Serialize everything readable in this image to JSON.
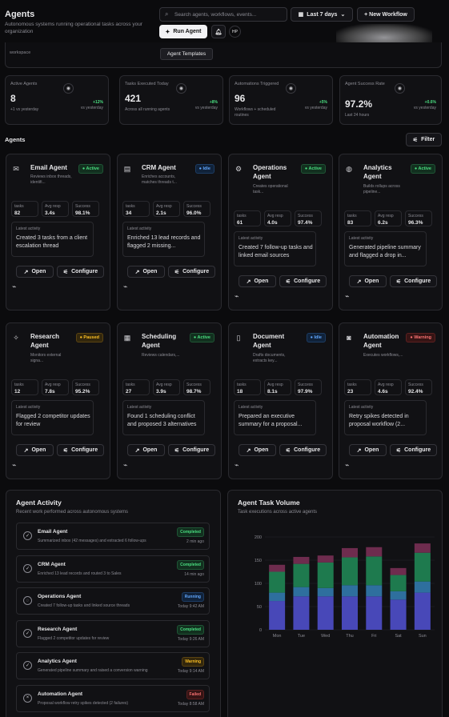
{
  "header": {
    "title": "Agents",
    "subtitle": "Autonomous systems running operational tasks across your organization",
    "search_placeholder": "Search agents, workflows, events...",
    "date_range": "Last 7 days",
    "new_workflow": "+ New Workflow",
    "run_agent": "Run Agent",
    "avatar": "HP",
    "tooltip": "Agent Templates",
    "hint": "workspace"
  },
  "kpis": [
    {
      "label": "Active Agents",
      "value": "8",
      "sub": "+1 vs yesterday",
      "change": "+12%",
      "change_sub": "vs yesterday",
      "icon": "robot-icon"
    },
    {
      "label": "Tasks Executed Today",
      "value": "421",
      "sub": "Across all running agents",
      "change": "+8%",
      "change_sub": "vs yesterday",
      "icon": "target-icon"
    },
    {
      "label": "Automations Triggered",
      "value": "96",
      "sub": "Workflows + scheduled routines",
      "change": "+5%",
      "change_sub": "vs yesterday",
      "icon": "gauge-icon"
    },
    {
      "label": "Agent Success Rate",
      "value": "97.2%",
      "sub": "Last 24 hours",
      "change": "+0.6%",
      "change_sub": "vs yesterday",
      "icon": "check-icon"
    }
  ],
  "agents_section": {
    "title": "Agents",
    "filter": "Filter"
  },
  "agents": [
    {
      "name": "Email Agent",
      "status": "Active",
      "desc": "Reviews inbox threads, identifi...",
      "tasks": "82",
      "avg": "3.4s",
      "success": "98.1%",
      "latest": "Created 3 tasks from a client escalation thread",
      "icon": "mail-icon"
    },
    {
      "name": "CRM Agent",
      "status": "Idle",
      "desc": "Enriches accounts, matches threads t...",
      "tasks": "34",
      "avg": "2.1s",
      "success": "96.0%",
      "latest": "Enriched 13 lead records and flagged 2 missing...",
      "icon": "table-icon"
    },
    {
      "name": "Operations Agent",
      "status": "Active",
      "desc": "Creates operational task...",
      "tasks": "61",
      "avg": "4.0s",
      "success": "97.4%",
      "latest": "Created 7 follow-up tasks and linked email sources",
      "icon": "gear-icon"
    },
    {
      "name": "Analytics Agent",
      "status": "Active",
      "desc": "Builds rollups across pipeline...",
      "tasks": "83",
      "avg": "6.2s",
      "success": "96.3%",
      "latest": "Generated pipeline summary and flagged a drop in...",
      "icon": "globe-icon"
    },
    {
      "name": "Research Agent",
      "status": "Paused",
      "desc": "Monitors external signa...",
      "tasks": "12",
      "avg": "7.8s",
      "success": "95.2%",
      "latest": "Flagged 2 competitor updates for review",
      "icon": "sparkle-icon"
    },
    {
      "name": "Scheduling Agent",
      "status": "Active",
      "desc": "Reviews calendars,...",
      "tasks": "27",
      "avg": "3.9s",
      "success": "98.7%",
      "latest": "Found 1 scheduling conflict and proposed 3 alternatives",
      "icon": "calendar-icon"
    },
    {
      "name": "Document Agent",
      "status": "Idle",
      "desc": "Drafts documents, extracts key...",
      "tasks": "18",
      "avg": "8.1s",
      "success": "97.9%",
      "latest": "Prepared an executive summary for a proposal...",
      "icon": "document-icon"
    },
    {
      "name": "Automation Agent",
      "status": "Warning",
      "desc": "Executes workflows,...",
      "tasks": "23",
      "avg": "4.6s",
      "success": "92.4%",
      "latest": "Retry spikes detected in proposal workflow (2...",
      "icon": "bot-icon"
    }
  ],
  "labels": {
    "tasks": "tasks",
    "avg": "Avg resp",
    "success": "Success",
    "latest": "Latest activity",
    "open": "Open",
    "configure": "Configure"
  },
  "activity": {
    "title": "Agent Activity",
    "subtitle": "Recent work performed across autonomous systems",
    "items": [
      {
        "name": "Email Agent",
        "desc": "Summarized inbox (42 messages) and extracted 6 follow-ups",
        "status": "Completed",
        "time": "2 min ago"
      },
      {
        "name": "CRM Agent",
        "desc": "Enriched 13 lead records and routed 3 to Sales",
        "status": "Completed",
        "time": "14 min ago"
      },
      {
        "name": "Operations Agent",
        "desc": "Created 7 follow-up tasks and linked source threads",
        "status": "Running",
        "time": "Today 9:42 AM"
      },
      {
        "name": "Research Agent",
        "desc": "Flagged 2 competitor updates for review",
        "status": "Completed",
        "time": "Today 9:26 AM"
      },
      {
        "name": "Analytics Agent",
        "desc": "Generated pipeline summary and raised a conversion warning",
        "status": "Warning",
        "time": "Today 9:14 AM"
      },
      {
        "name": "Automation Agent",
        "desc": "Proposal workflow retry spikes detected (2 failures)",
        "status": "Failed",
        "time": "Today 8:58 AM"
      }
    ]
  },
  "chart_data": {
    "type": "bar",
    "title": "Agent Task Volume",
    "subtitle": "Task executions across active agents",
    "categories": [
      "Mon",
      "Tue",
      "Wed",
      "Thu",
      "Fri",
      "Sat",
      "Sun"
    ],
    "ylim": [
      0,
      200
    ],
    "yticks": [
      0,
      50,
      100,
      150,
      200
    ],
    "series": [
      {
        "values": [
          62,
          72,
          72,
          72,
          72,
          65,
          80
        ],
        "color": "#4848b8"
      },
      {
        "values": [
          18,
          20,
          18,
          24,
          24,
          18,
          24
        ],
        "color": "#2e6f9e"
      },
      {
        "values": [
          45,
          50,
          55,
          60,
          62,
          35,
          62
        ],
        "color": "#1e7a4e"
      },
      {
        "values": [
          15,
          15,
          15,
          20,
          20,
          15,
          20
        ],
        "color": "#6e2c4e"
      }
    ],
    "grid": true
  }
}
